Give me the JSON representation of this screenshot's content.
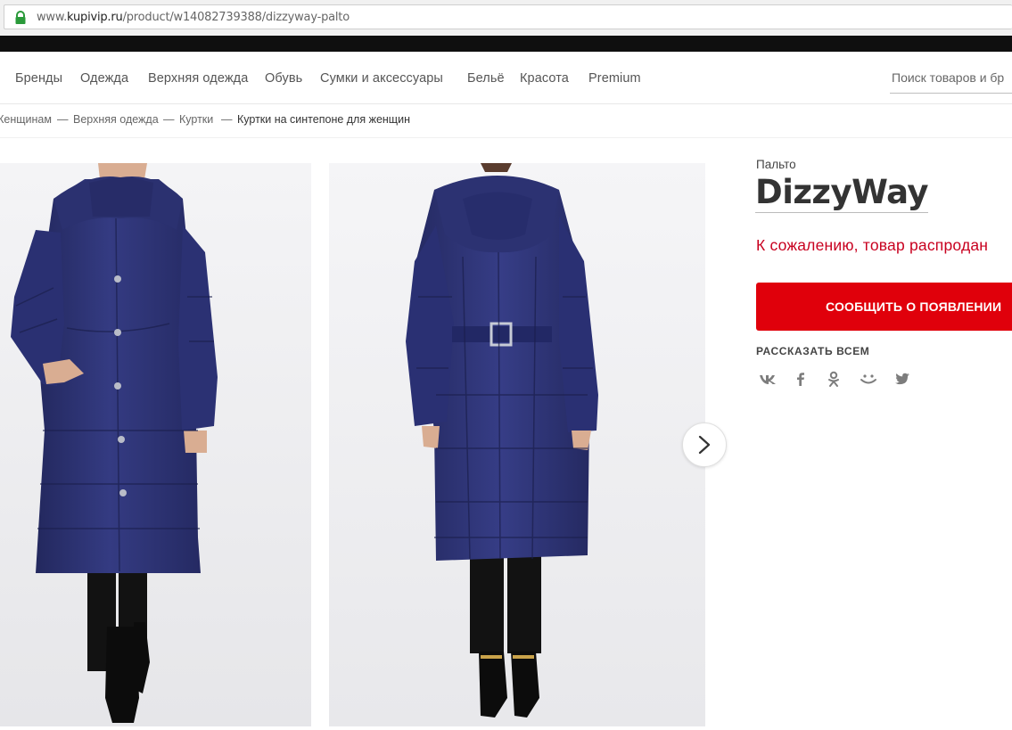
{
  "browser": {
    "url_prefix": "www.",
    "url_domain": "kupivip.ru",
    "url_path": "/product/w14082739388/dizzyway-palto"
  },
  "nav": {
    "items": [
      "Бренды",
      "Одежда",
      "Верхняя одежда",
      "Обувь",
      "Сумки и аксессуары",
      "Бельё",
      "Красота",
      "Premium"
    ],
    "search_placeholder": "Поиск товаров и бр"
  },
  "breadcrumb": {
    "items": [
      "Женщинам",
      "Верхняя одежда",
      "Куртки"
    ],
    "separator": "—",
    "current": "Куртки на синтепоне для женщин"
  },
  "product": {
    "category": "Пальто",
    "brand": "DizzyWay",
    "status": "К сожалению, товар распродан",
    "notify_button": "СООБЩИТЬ О ПОЯВЛЕНИИ",
    "share_title": "РАССКАЗАТЬ ВСЕМ",
    "share_icons": [
      "vk-icon",
      "facebook-icon",
      "odnoklassniki-icon",
      "moimir-icon",
      "twitter-icon"
    ]
  },
  "colors": {
    "accent_red": "#e0000b",
    "status_red": "#c8001f",
    "coat_navy": "#2c3270"
  }
}
